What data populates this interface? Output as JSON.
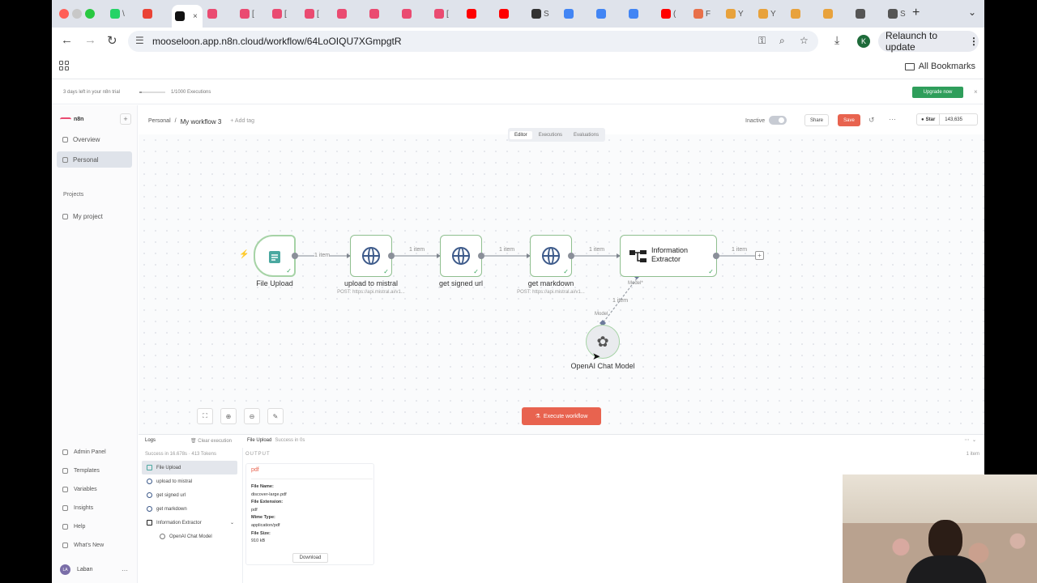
{
  "browser": {
    "url": "mooseloon.app.n8n.cloud/workflow/64LoOIQU7XGmpgtR",
    "relaunch_label": "Relaunch to update",
    "profile_initial": "K",
    "all_bookmarks": "All Bookmarks",
    "tab_favicons": [
      "#25d366",
      "#ea4335",
      "#111111",
      "#ea4b71",
      "#ea4b71",
      "#ea4b71",
      "#ea4b71",
      "#ea4b71",
      "#ea4b71",
      "#ea4b71",
      "#ea4b71",
      "#ff0000",
      "#ff0000",
      "#333333",
      "#4285f4",
      "#4285f4",
      "#4285f4",
      "#ff0000",
      "#e8704a",
      "#e8a23c",
      "#e8a23c",
      "#e8a23c",
      "#e8a23c",
      "#555555",
      "#555555"
    ],
    "tab_titles": [
      "\\",
      "",
      "",
      "",
      "[",
      "[",
      "[",
      "",
      "",
      "",
      "[",
      "",
      "",
      "S",
      "",
      "",
      "",
      "(",
      "F",
      "Y",
      "Y",
      "",
      "",
      "",
      "S"
    ]
  },
  "banner": {
    "trial_text": "3 days left in your n8n trial",
    "executions": "1/1000 Executions",
    "executions_fraction": 0.1,
    "upgrade_label": "Upgrade now",
    "close": "×"
  },
  "sidebar": {
    "logo": "n8n",
    "plus": "+",
    "items": [
      {
        "label": "Overview"
      },
      {
        "label": "Personal"
      }
    ],
    "projects_heading": "Projects",
    "project": "My project",
    "bottom": [
      {
        "label": "Admin Panel"
      },
      {
        "label": "Templates"
      },
      {
        "label": "Variables"
      },
      {
        "label": "Insights"
      },
      {
        "label": "Help"
      },
      {
        "label": "What's New"
      }
    ],
    "user": {
      "initials": "LA",
      "name": "Laban"
    }
  },
  "header": {
    "breadcrumb_root": "Personal",
    "separator": "/",
    "workflow_name": "My workflow 3",
    "add_tag": "+ Add tag",
    "inactive_label": "Inactive",
    "share_label": "Share",
    "save_label": "Save",
    "star_label": "Star",
    "star_count": "143,635",
    "view_tabs": [
      "Editor",
      "Executions",
      "Evaluations"
    ]
  },
  "workflow": {
    "nodes": [
      {
        "label": "File Upload",
        "sub": ""
      },
      {
        "label": "upload to mistral",
        "sub": "POST: https://api.mistral.ai/v1..."
      },
      {
        "label": "get signed url",
        "sub": ""
      },
      {
        "label": "get markdown",
        "sub": "POST: https://api.mistral.ai/v1..."
      },
      {
        "label_line1": "Information",
        "label_line2": "Extractor"
      }
    ],
    "edge_label": "1 item",
    "model_label_top": "Model*",
    "model_label_bottom": "Model",
    "sub_edge_label": "1 item",
    "model_node": "OpenAI Chat Model",
    "execute_label": "Execute workflow"
  },
  "logs": {
    "title": "Logs",
    "clear": "Clear execution",
    "selected_node": "File Upload",
    "selected_status": "Success in 0s",
    "meta": "Success in 16.678s · 413 Tokens",
    "output_heading": "OUTPUT",
    "item_count": "1 item",
    "items": [
      {
        "label": "File Upload"
      },
      {
        "label": "upload to mistral"
      },
      {
        "label": "get signed url"
      },
      {
        "label": "get markdown"
      },
      {
        "label": "Information Extractor"
      },
      {
        "label": "OpenAI Chat Model"
      }
    ],
    "output": {
      "title": "pdf",
      "rows": [
        "File Name:",
        "discover-large.pdf",
        "File Extension:",
        "pdf",
        "Mime Type:",
        "application/pdf",
        "File Size:",
        "910 kB"
      ],
      "download": "Download"
    }
  }
}
